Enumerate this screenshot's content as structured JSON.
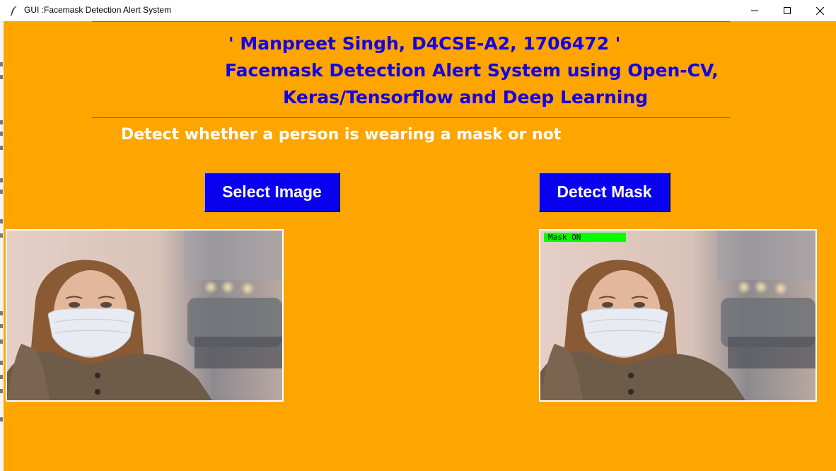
{
  "window": {
    "title": "GUI :Facemask Detection Alert System"
  },
  "header": {
    "line1": "' Manpreet Singh, D4CSE-A2, 1706472 '",
    "line2": "Facemask Detection Alert System using Open-CV,",
    "line3": "Keras/Tensorflow and Deep Learning"
  },
  "subtitle": "Detect whether a person is wearing a mask or not",
  "buttons": {
    "select_label": "Select Image",
    "detect_label": "Detect Mask"
  },
  "result": {
    "label": "Mask  ON"
  },
  "colors": {
    "background": "#ffa500",
    "heading": "#1400e0",
    "button": "#0a00f0",
    "rule": "#ff2a00",
    "mask_label": "#00ff00"
  },
  "icons": [
    "feather-icon",
    "minimize-icon",
    "maximize-icon",
    "close-icon"
  ]
}
